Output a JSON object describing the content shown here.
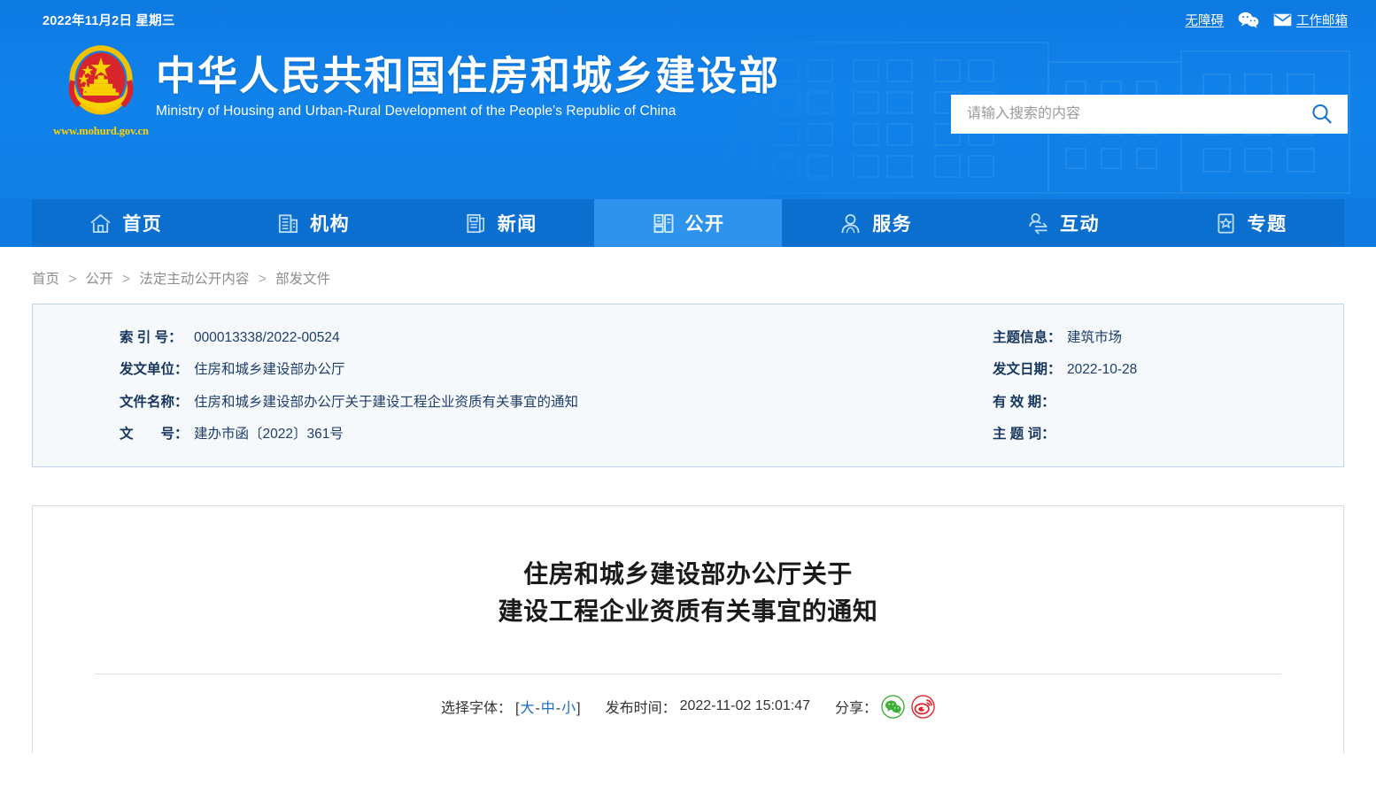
{
  "topbar": {
    "date": "2022年11月2日 星期三",
    "accessibility_label": "无障碍",
    "wechat_icon": "wechat-icon",
    "mail_icon": "mail-icon",
    "mail_label": "工作邮箱"
  },
  "brand": {
    "emblem_icon": "national-emblem-icon",
    "url": "www.mohurd.gov.cn",
    "name_cn": "中华人民共和国住房和城乡建设部",
    "name_en": "Ministry of Housing and Urban-Rural Development of the People's Republic of China"
  },
  "search": {
    "placeholder": "请输入搜索的内容",
    "value": "",
    "icon": "search-icon"
  },
  "nav": {
    "items": [
      {
        "label": "首页",
        "icon": "home-icon",
        "active": false
      },
      {
        "label": "机构",
        "icon": "building-icon",
        "active": false
      },
      {
        "label": "新闻",
        "icon": "news-icon",
        "active": false
      },
      {
        "label": "公开",
        "icon": "disclosure-icon",
        "active": true
      },
      {
        "label": "服务",
        "icon": "service-person-icon",
        "active": false
      },
      {
        "label": "互动",
        "icon": "interaction-icon",
        "active": false
      },
      {
        "label": "专题",
        "icon": "star-topic-icon",
        "active": false
      }
    ]
  },
  "breadcrumb": {
    "items": [
      "首页",
      "公开",
      "法定主动公开内容",
      "部发文件"
    ],
    "separator": ">"
  },
  "meta": {
    "left": [
      {
        "key": "索 引 号：",
        "value": "000013338/2022-00524"
      },
      {
        "key": "发文单位：",
        "value": "住房和城乡建设部办公厅"
      },
      {
        "key": "文件名称：",
        "value": "住房和城乡建设部办公厅关于建设工程企业资质有关事宜的通知"
      },
      {
        "key": "文　　号：",
        "value": "建办市函〔2022〕361号"
      }
    ],
    "right": [
      {
        "key": "主题信息：",
        "value": "建筑市场"
      },
      {
        "key": "发文日期：",
        "value": "2022-10-28"
      },
      {
        "key": "有 效 期：",
        "value": ""
      },
      {
        "key": "主 题 词：",
        "value": ""
      }
    ]
  },
  "article": {
    "title_line1": "住房和城乡建设部办公厅关于",
    "title_line2": "建设工程企业资质有关事宜的通知",
    "font_size_label": "选择字体：",
    "font_bracket_open": "[",
    "font_bracket_close": "]",
    "font_large": "大",
    "font_medium": "中",
    "font_small": "小",
    "dash": "-",
    "publish_label": "发布时间：",
    "publish_time": "2022-11-02 15:01:47",
    "share_label": "分享：",
    "share_wechat_icon": "wechat-share-icon",
    "share_weibo_icon": "weibo-share-icon"
  },
  "colors": {
    "header_blue": "#0f7ae0",
    "nav_blue": "#0b6fd0",
    "nav_active": "#2e93ec",
    "emblem_gold": "#ffd200",
    "meta_text": "#1f3d6b",
    "link_blue": "#1a6fc4",
    "wechat_green": "#3cb034",
    "weibo_red": "#e2222b"
  }
}
